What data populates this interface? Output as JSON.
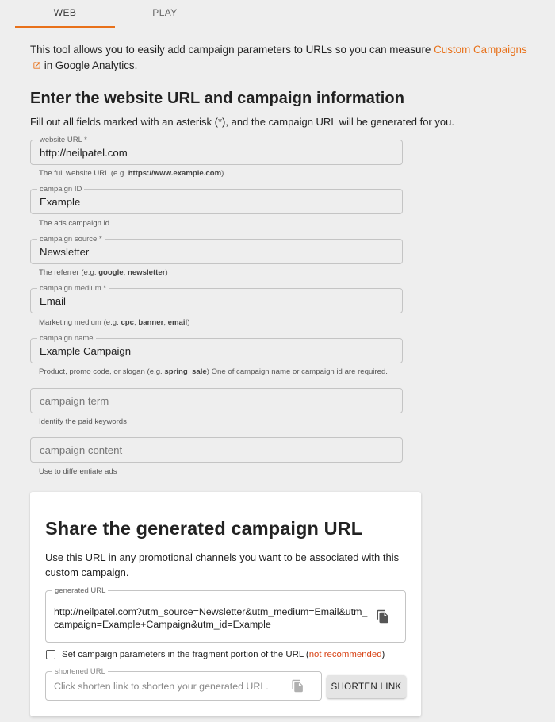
{
  "tabs": [
    {
      "label": "WEB",
      "active": true
    },
    {
      "label": "PLAY",
      "active": false
    }
  ],
  "accent_color": "#e8711a",
  "intro": {
    "text_before": "This tool allows you to easily add campaign parameters to URLs so you can measure ",
    "link_text": "Custom Campaigns",
    "text_after": " in Google Analytics.",
    "link_icon": "external-link-icon"
  },
  "section_title": "Enter the website URL and campaign information",
  "instructions": "Fill out all fields marked with an asterisk (*), and the campaign URL will be generated for you.",
  "fields": [
    {
      "label": "website URL *",
      "value": "http://neilpatel.com",
      "help_prefix": "The full website URL (e.g. ",
      "help_bold": "https://www.example.com",
      "help_suffix": ")"
    },
    {
      "label": "campaign ID",
      "value": "Example",
      "help": "The ads campaign id."
    },
    {
      "label": "campaign source *",
      "value": "Newsletter",
      "help_prefix": "The referrer (e.g. ",
      "help_bold": "google",
      "help_mid": ", ",
      "help_bold2": "newsletter",
      "help_suffix": ")"
    },
    {
      "label": "campaign medium *",
      "value": "Email",
      "help_prefix": "Marketing medium (e.g. ",
      "help_bold": "cpc",
      "help_mid": ", ",
      "help_bold2": "banner",
      "help_mid2": ", ",
      "help_bold3": "email",
      "help_suffix": ")"
    },
    {
      "label": "campaign name",
      "value": "Example Campaign",
      "help_prefix": "Product, promo code, or slogan (e.g. ",
      "help_bold": "spring_sale",
      "help_suffix": ") One of campaign name or campaign id are required."
    },
    {
      "placeholder": "campaign term",
      "help": "Identify the paid keywords"
    },
    {
      "placeholder": "campaign content",
      "help": "Use to differentiate ads"
    }
  ],
  "share": {
    "title": "Share the generated campaign URL",
    "description": "Use this URL in any promotional channels you want to be associated with this custom campaign.",
    "generated_label": "generated URL",
    "generated_url": "http://neilpatel.com?utm_source=Newsletter&utm_medium=Email&utm_campaign=Example+Campaign&utm_id=Example",
    "copy_icon": "copy-icon",
    "checkbox_label": "Set campaign parameters in the fragment portion of the URL (",
    "checkbox_warning": "not recommended",
    "checkbox_close": ")",
    "checkbox_checked": false,
    "shortened_label": "shortened URL",
    "shortened_placeholder": "Click shorten link to shorten your generated URL.",
    "shorten_button": "SHORTEN LINK"
  }
}
